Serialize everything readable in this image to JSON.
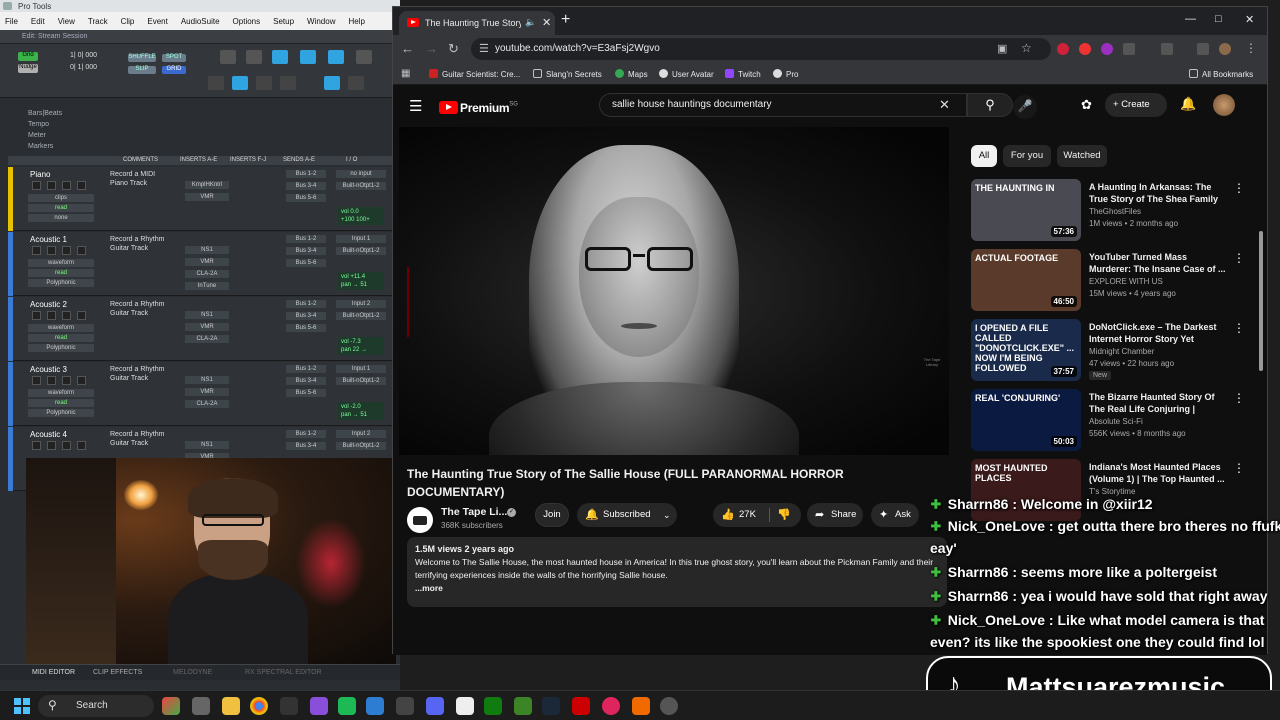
{
  "protools": {
    "title": "Pro Tools",
    "menu": [
      "File",
      "Edit",
      "View",
      "Track",
      "Clip",
      "Event",
      "AudioSuite",
      "Options",
      "Setup",
      "Window",
      "Help"
    ],
    "edit_window_title": "Edit: Stream Session",
    "grid_label": "Grid",
    "grid_value": "1| 0| 000",
    "nudge_label": "Nudge",
    "nudge_value": "0| 1| 000",
    "modes": [
      "SHUFFLE",
      "SPOT",
      "SLIP",
      "GRID"
    ],
    "rulers": [
      "Bars|Beats",
      "Tempo",
      "Meter",
      "Markers"
    ],
    "column_headers": [
      "COMMENTS",
      "INSERTS A-E",
      "INSERTS F-J",
      "SENDS A-E",
      "I / O"
    ],
    "tracks": [
      {
        "name": "Piano",
        "comment": "Record a MIDI Piano Track",
        "sub1": "clips",
        "sub2": "read",
        "sub3": "none",
        "inserts": [
          "KmplHKntrl",
          "VMR"
        ],
        "sends": [
          "Bus 1-2",
          "Bus 3-4",
          "Bus 5-6"
        ],
        "io": [
          "no input",
          "Built-nOtpt1-2"
        ],
        "vol": "vol 0.0",
        "pan": "+100 100+",
        "color": "#e6c200"
      },
      {
        "name": "Acoustic 1",
        "comment": "Record a Rhythm Guitar Track",
        "sub1": "waveform",
        "sub2": "read",
        "sub3": "Polyphonic",
        "inserts": [
          "NS1",
          "VMR",
          "CLA-2A",
          "InTune"
        ],
        "sends": [
          "Bus 1-2",
          "Bus 3-4",
          "Bus 5-6"
        ],
        "io": [
          "Input 1",
          "Built-nOtpt1-2"
        ],
        "vol": "vol +11.4",
        "pan": "pan → 51",
        "color": "#3a7bd5"
      },
      {
        "name": "Acoustic 2",
        "comment": "Record a Rhythm Guitar Track",
        "sub1": "waveform",
        "sub2": "read",
        "sub3": "Polyphonic",
        "inserts": [
          "NS1",
          "VMR",
          "CLA-2A"
        ],
        "sends": [
          "Bus 1-2",
          "Bus 3-4",
          "Bus 5-6"
        ],
        "io": [
          "Input 2",
          "Built-nOtpt1-2"
        ],
        "vol": "vol -7.3",
        "pan": "pan 22 →",
        "color": "#3a7bd5"
      },
      {
        "name": "Acoustic 3",
        "comment": "Record a Rhythm Guitar Track",
        "sub1": "waveform",
        "sub2": "read",
        "sub3": "Polyphonic",
        "inserts": [
          "NS1",
          "VMR",
          "CLA-2A"
        ],
        "sends": [
          "Bus 1-2",
          "Bus 3-4",
          "Bus 5-6"
        ],
        "io": [
          "Input 1",
          "Built-nOtpt1-2"
        ],
        "vol": "vol -2.0",
        "pan": "pan → 51",
        "color": "#3a7bd5"
      },
      {
        "name": "Acoustic 4",
        "comment": "Record a Rhythm Guitar Track",
        "sub1": "",
        "sub2": "",
        "sub3": "",
        "inserts": [
          "NS1",
          "VMR"
        ],
        "sends": [
          "Bus 1-2",
          "Bus 3-4"
        ],
        "io": [
          "Input 2",
          "Built-nOtpt1-2"
        ],
        "vol": "",
        "pan": "",
        "color": "#3a7bd5"
      }
    ],
    "bottom_tabs": [
      "MIDI EDITOR",
      "CLIP EFFECTS",
      "MELODYNE",
      "RX SPECTRAL EDITOR"
    ]
  },
  "chrome": {
    "tab_title": "The Haunting True Story of",
    "url": "youtube.com/watch?v=E3aFsj2Wgvo",
    "bookmarks": [
      "Guitar Scientist: Cre...",
      "Slang'n Secrets",
      "Maps",
      "User Avatar",
      "Twitch",
      "Pro"
    ],
    "all_bookmarks": "All Bookmarks"
  },
  "youtube": {
    "logo": "Premium",
    "logo_region": "SG",
    "search_query": "sallie house hauntings documentary",
    "create_label": "Create",
    "watermark": "The Tape Library",
    "video_title": "The Haunting True Story of The Sallie House (FULL PARANORMAL HORROR DOCUMENTARY)",
    "channel_name": "The Tape Li...",
    "subscribers": "368K subscribers",
    "join_label": "Join",
    "subscribed_label": "Subscribed",
    "likes": "27K",
    "share_label": "Share",
    "ask_label": "Ask",
    "description_meta": "1.5M views  2 years ago",
    "description_text": "Welcome to The Sallie House, the most haunted house in America! In this true ghost story, you'll learn about the Pickman Family and their terrifying experiences inside the walls of the horrifying Sallie house.",
    "more_label": "...more",
    "chips": [
      "All",
      "For you",
      "Watched"
    ],
    "recommendations": [
      {
        "title": "A Haunting In Arkansas: The True Story of The Shea Family",
        "channel": "TheGhostFiles",
        "meta": "1M views • 2 months ago",
        "duration": "57:36",
        "badge": "",
        "thumb_text": "THE HAUNTING IN",
        "thumb_bg": "#4a4a52"
      },
      {
        "title": "YouTuber Turned Mass Murderer: The Insane Case of ...",
        "channel": "EXPLORE WITH US",
        "meta": "15M views • 4 years ago",
        "duration": "46:50",
        "badge": "",
        "thumb_text": "ACTUAL FOOTAGE",
        "thumb_bg": "#5a3a2a"
      },
      {
        "title": "DoNotClick.exe – The Darkest Internet Horror Story Yet",
        "channel": "Midnight Chamber",
        "meta": "47 views • 22 hours ago",
        "duration": "37:57",
        "badge": "New",
        "thumb_text": "I OPENED A FILE CALLED \"DONOTCLICK.EXE\" ... NOW I'M BEING FOLLOWED",
        "thumb_bg": "#1a2a4a"
      },
      {
        "title": "The Bizarre Haunted Story Of The Real Life Conjuring | Horro...",
        "channel": "Absolute Sci-Fi",
        "meta": "556K views • 8 months ago",
        "duration": "50:03",
        "badge": "",
        "thumb_text": "REAL 'CONJURING'",
        "thumb_bg": "#0a1a40"
      },
      {
        "title": "Indiana's Most Haunted Places (Volume 1) | The Top Haunted ...",
        "channel": "T's Storytime",
        "meta": "",
        "duration": "",
        "badge": "",
        "thumb_text": "MOST HAUNTED PLACES",
        "thumb_bg": "#3a1a1a"
      }
    ]
  },
  "chat": [
    {
      "user": "Sharrn86",
      "text": "Welcome in @xiir12"
    },
    {
      "user": "Nick_OneLove",
      "text": "get outta there bro theres no ffufkin"
    },
    {
      "user": "",
      "text": "eay'"
    },
    {
      "user": "Sharrn86",
      "text": "seems more like a poltergeist"
    },
    {
      "user": "Sharrn86",
      "text": "yea i would have sold that right away"
    },
    {
      "user": "Nick_OneLove",
      "text": "Like what model camera is that"
    },
    {
      "user": "",
      "text": "even? its like the spookiest one they could find lol"
    }
  ],
  "tiktok_handle": "Mattsuarezmusic",
  "taskbar": {
    "search_label": "Search"
  }
}
